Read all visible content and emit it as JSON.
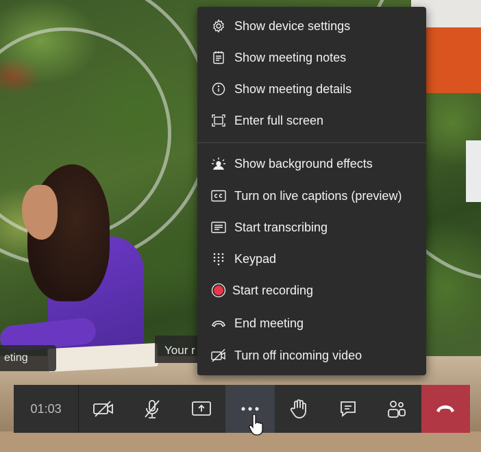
{
  "video": {
    "caption_left": "eting",
    "caption_mid": "Your r"
  },
  "menu": {
    "items": [
      {
        "label": "Show device settings",
        "icon": "gear-icon"
      },
      {
        "label": "Show meeting notes",
        "icon": "notes-icon"
      },
      {
        "label": "Show meeting details",
        "icon": "info-icon"
      },
      {
        "label": "Enter full screen",
        "icon": "fullscreen-icon"
      },
      {
        "label": "Show background effects",
        "icon": "background-effects-icon"
      },
      {
        "label": "Turn on live captions (preview)",
        "icon": "captions-icon"
      },
      {
        "label": "Start transcribing",
        "icon": "transcript-icon"
      },
      {
        "label": "Keypad",
        "icon": "keypad-icon"
      },
      {
        "label": "Start recording",
        "icon": "record-icon"
      },
      {
        "label": "End meeting",
        "icon": "end-meeting-icon"
      },
      {
        "label": "Turn off incoming video",
        "icon": "video-off-icon"
      }
    ]
  },
  "controls": {
    "timer": "01:03",
    "buttons": [
      {
        "name": "camera-off-icon"
      },
      {
        "name": "mic-off-icon"
      },
      {
        "name": "share-screen-icon"
      },
      {
        "name": "more-options-icon",
        "active": true
      },
      {
        "name": "raise-hand-icon"
      },
      {
        "name": "chat-icon"
      },
      {
        "name": "participants-icon"
      }
    ],
    "hangup": "hang-up-icon"
  },
  "colors": {
    "menu_bg": "#2d2c2c",
    "bar_bg": "#2f2f2f",
    "hangup": "#b23744",
    "record": "#e8364b"
  }
}
